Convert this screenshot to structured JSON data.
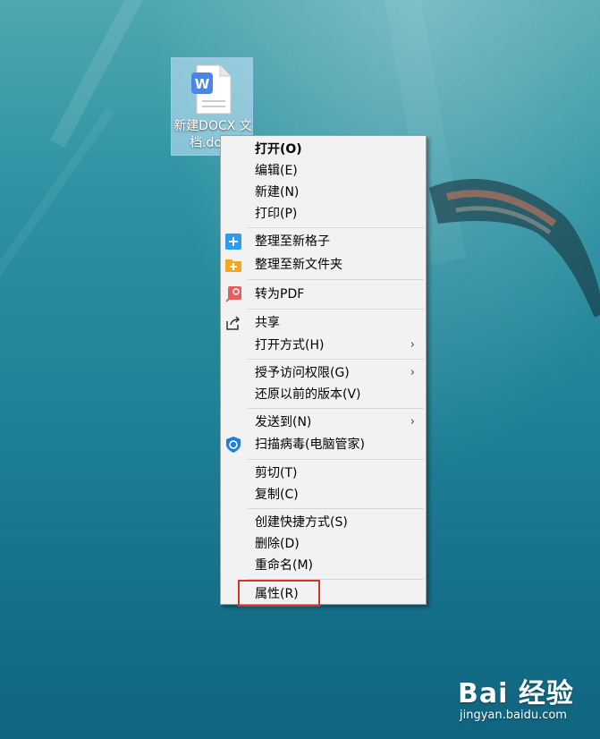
{
  "desktop": {
    "file_icon": {
      "name_line1": "新建DOCX 文",
      "name_line2": "档.docx"
    }
  },
  "context_menu": {
    "items": [
      {
        "label": "打开(O)",
        "bold": true,
        "icon": ""
      },
      {
        "label": "编辑(E)",
        "icon": ""
      },
      {
        "label": "新建(N)",
        "icon": ""
      },
      {
        "label": "打印(P)",
        "icon": ""
      },
      {
        "label": "整理至新格子",
        "icon": "blue-plus-icon"
      },
      {
        "label": "整理至新文件夹",
        "icon": "orange-folder-plus-icon"
      },
      {
        "label": "转为PDF",
        "icon": "pdf-convert-icon"
      },
      {
        "label": "共享",
        "icon": "share-icon"
      },
      {
        "label": "打开方式(H)",
        "icon": "",
        "submenu": true
      },
      {
        "label": "授予访问权限(G)",
        "icon": "",
        "submenu": true
      },
      {
        "label": "还原以前的版本(V)",
        "icon": ""
      },
      {
        "label": "发送到(N)",
        "icon": "",
        "submenu": true
      },
      {
        "label": "扫描病毒(电脑管家)",
        "icon": "shield-icon"
      },
      {
        "label": "剪切(T)",
        "icon": ""
      },
      {
        "label": "复制(C)",
        "icon": ""
      },
      {
        "label": "创建快捷方式(S)",
        "icon": ""
      },
      {
        "label": "删除(D)",
        "icon": ""
      },
      {
        "label": "重命名(M)",
        "icon": ""
      },
      {
        "label": "属性(R)",
        "icon": "",
        "highlighted": true
      }
    ],
    "submenu_arrow": "›"
  },
  "watermark": {
    "logo": "Bai 经验",
    "url": "jingyan.baidu.com"
  },
  "colors": {
    "highlight_box": "#d9322a",
    "menu_bg": "#f2f2f2"
  }
}
